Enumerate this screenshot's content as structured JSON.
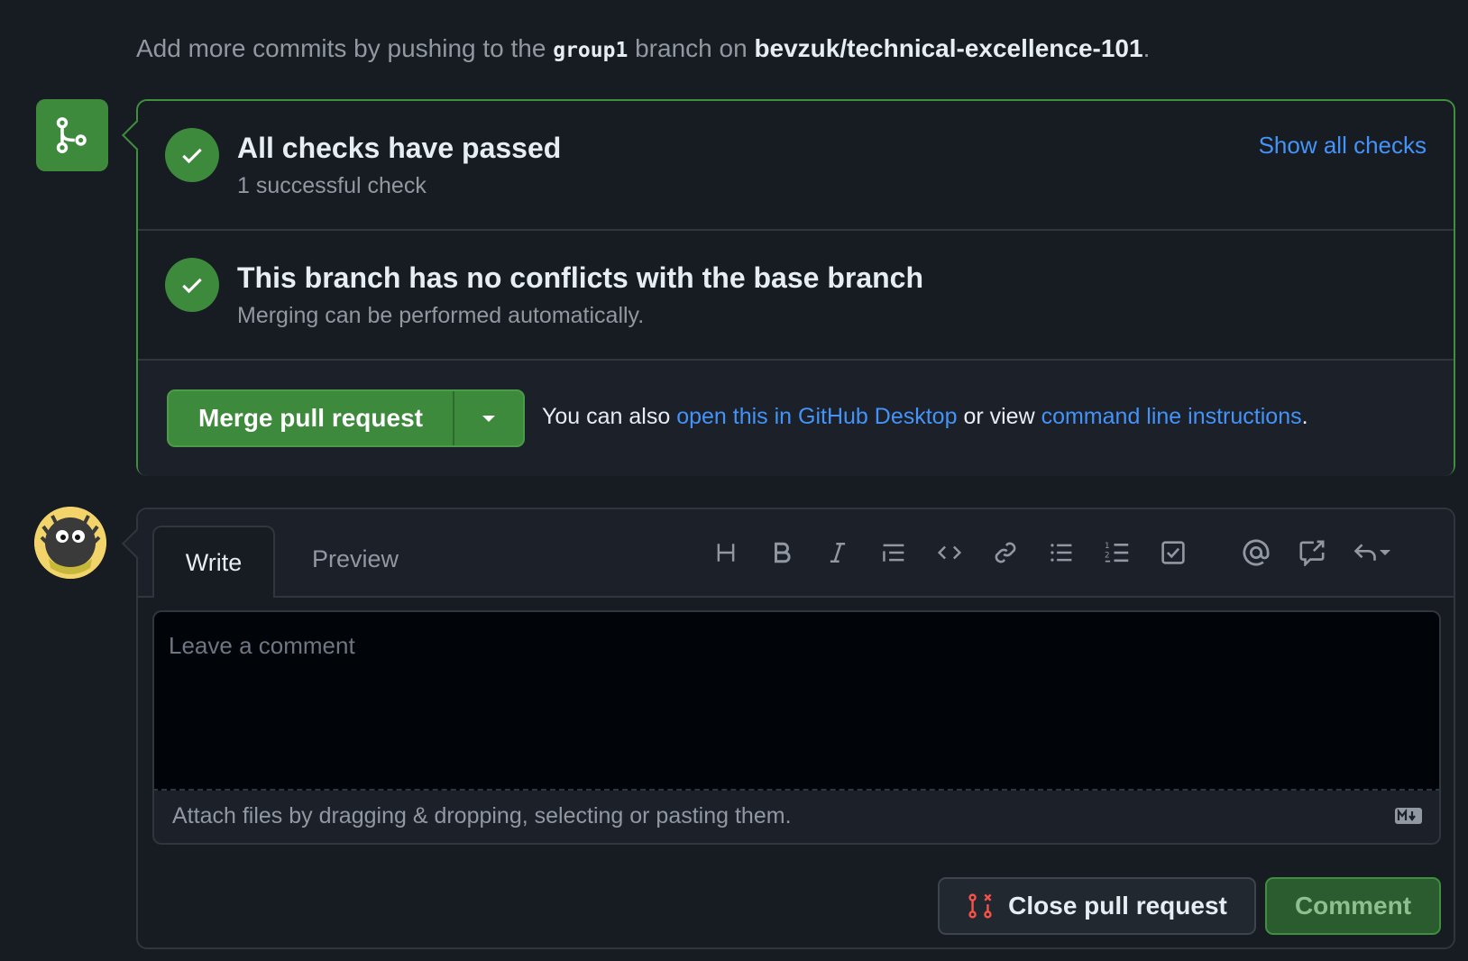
{
  "hint": {
    "prefix": "Add more commits by pushing to the",
    "branch": "group1",
    "middle": "branch on",
    "repo": "bevzuk/technical-excellence-101",
    "suffix": "."
  },
  "merge_panel": {
    "checks_title": "All checks have passed",
    "checks_sub": "1 successful check",
    "show_all": "Show all checks",
    "conflicts_title": "This branch has no conflicts with the base branch",
    "conflicts_sub": "Merging can be performed automatically.",
    "merge_button": "Merge pull request",
    "also_prefix": "You can also",
    "desktop_link": "open this in GitHub Desktop",
    "also_middle": "or view",
    "cli_link": "command line instructions",
    "also_suffix": "."
  },
  "comment": {
    "tab_write": "Write",
    "tab_preview": "Preview",
    "toolbar_icons": [
      "heading-icon",
      "bold-icon",
      "italic-icon",
      "quote-icon",
      "code-icon",
      "link-icon",
      "unordered-list-icon",
      "ordered-list-icon",
      "task-list-icon",
      "mention-icon",
      "reference-icon",
      "reply-icon"
    ],
    "placeholder": "Leave a comment",
    "attach_text": "Attach files by dragging & dropping, selecting or pasting them.",
    "close_button": "Close pull request",
    "comment_button": "Comment"
  },
  "colors": {
    "success": "#3e8a3d",
    "link": "#4493f8",
    "danger": "#f85149",
    "background": "#171b22"
  }
}
